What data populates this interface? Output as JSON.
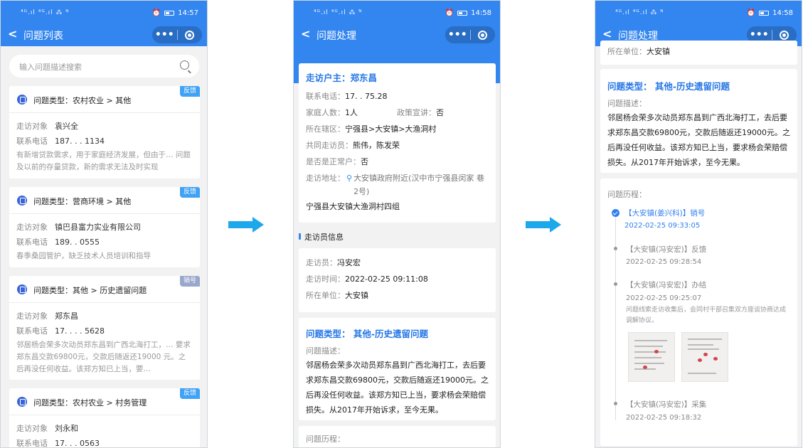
{
  "status": {
    "signal": "⁴ᴳ.ıl ⁴ᴳ.ıl ⁂ ᴺ",
    "p1_time": "14:57",
    "p2_time": "14:58",
    "p3_time": "14:58"
  },
  "screen1": {
    "title": "问题列表",
    "search_placeholder": "输入问题描述搜索",
    "cards": [
      {
        "type": "问题类型：农村农业 > 其他",
        "tag": "反馈",
        "obj_label": "走访对象",
        "obj": "袁兴全",
        "phone_label": "联系电话",
        "phone": "187. . . 1134",
        "desc": "有新增贷款需求，用于家庭经济发展，但由于… 问题及以前的存量贷款，新的需求无法及时实现"
      },
      {
        "type": "问题类型：营商环境 > 其他",
        "tag": "反馈",
        "obj_label": "走访对象",
        "obj": "镇巴县富力实业有限公司",
        "phone_label": "联系电话",
        "phone": "189. . 0555",
        "desc": "春季桑园管护，缺乏技术人员培训和指导"
      },
      {
        "type": "问题类型：其他 > 历史遗留问题",
        "tag": "销号",
        "obj_label": "走访对象",
        "obj": "郑东昌",
        "phone_label": "联系电话",
        "phone": "17. . . . 5628",
        "desc": "邻居杨会荣多次动员郑东昌到广西北海打工，… 要求郑东昌交款69800元，交款后随返还19000 元。之后再没任何收益。该郑方知已上当，要…"
      },
      {
        "type": "问题类型：农村农业 > 村务管理",
        "tag": "反馈",
        "obj_label": "走访对象",
        "obj": "刘永和",
        "phone_label": "联系电话",
        "phone": "17. . . 0563",
        "desc": ""
      }
    ]
  },
  "screen2": {
    "title": "问题处理",
    "host": "走访户主：郑东昌",
    "phone_label": "联系电话：",
    "phone": "17. . 75.28",
    "family_label": "家庭人数：",
    "family": "1人",
    "policy_label": "政策宣讲：",
    "policy": "否",
    "area_label": "所在辖区：",
    "area": "宁强县>大安镇>大渔洞村",
    "co_label": "共同走访员：",
    "co": "熊伟，陈发荣",
    "normal_label": "是否是正常户：",
    "normal": "否",
    "addr_label": "走访地址：",
    "addr_loc": "大安镇政府附近(汉中市宁强县闵家 巷2号)",
    "addr_text": "宁强县大安镇大渔洞村四组",
    "visitor_section": "走访员信息",
    "visitor_label": "走访员：",
    "visitor": "冯安宏",
    "time_label": "走访时间：",
    "time": "2022-02-25 09:11:08",
    "unit_label": "所在单位：",
    "unit": "大安镇",
    "ptype": "问题类型：  其他-历史遗留问题",
    "pdesc_label": "问题描述：",
    "pdesc": "邻居杨会荣多次动员郑东昌到广西北海打工，去后要求郑东昌交款69800元，交款后随返还19000元。之后再没任何收益。该郑方知已上当，要求杨会荣赔偿损失。从2017年开始诉求，至今无果。",
    "history_label": "问题历程："
  },
  "screen3": {
    "title": "问题处理",
    "unit_label": "所在单位：",
    "unit": "大安镇",
    "ptype": "问题类型：  其他-历史遗留问题",
    "pdesc_label": "问题描述：",
    "pdesc": "邻居杨会荣多次动员郑东昌到广西北海打工，去后要求郑东昌交款69800元，交款后随返还19000元。之后再没任何收益。该郑方知已上当，要求杨会荣赔偿损失。从2017年开始诉求，至今无果。",
    "history_label": "问题历程：",
    "timeline": [
      {
        "title": "【大安镇(姜兴科)】销号",
        "time": "2022-02-25 09:33:05"
      },
      {
        "title": "【大安镇(冯安宏)】反馈",
        "time": "2022-02-25 09:28:54"
      },
      {
        "title": "【大安镇(冯安宏)】办结",
        "time": "2022-02-25 09:25:07",
        "note": "问题线索走访收集后，会同村干部召集双方座谈协商达成调解协议。"
      },
      {
        "title": "【大安镇(冯安宏)】采集",
        "time": "2022-02-25 09:18:32"
      }
    ]
  },
  "colors": {
    "primary": "#3385f0",
    "arrow": "#1ea8ec"
  },
  "icons": [
    "back-icon",
    "more-icon",
    "record-icon",
    "search-icon",
    "doc-icon",
    "location-icon",
    "check-icon"
  ]
}
